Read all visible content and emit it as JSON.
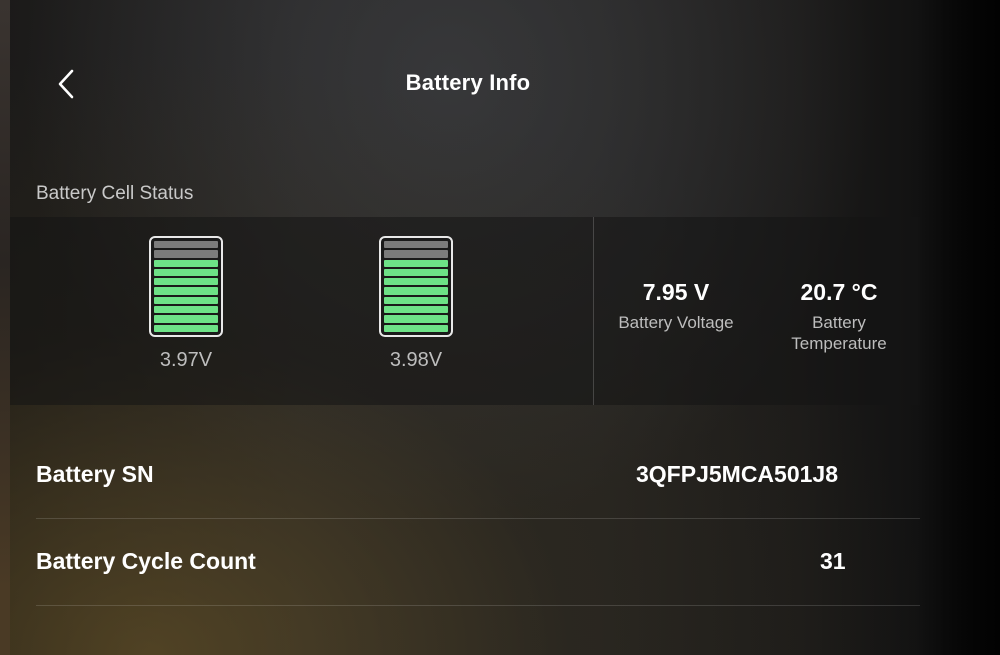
{
  "header": {
    "title": "Battery Info",
    "back_icon": "chevron-left-icon"
  },
  "cell_status": {
    "label": "Battery Cell Status",
    "cells": [
      {
        "voltage": "3.97V",
        "level_fraction": 0.8,
        "bars_total": 10,
        "bars_filled": 8
      },
      {
        "voltage": "3.98V",
        "level_fraction": 0.8,
        "bars_total": 10,
        "bars_filled": 8
      }
    ],
    "colors": {
      "filled": "#6de287",
      "empty": "#7b7b7b"
    }
  },
  "stats": {
    "voltage": {
      "value": "7.95 V",
      "label": "Battery Voltage"
    },
    "temperature": {
      "value": "20.7 °C",
      "label_line1": "Battery",
      "label_line2": "Temperature"
    }
  },
  "info": {
    "sn": {
      "label": "Battery SN",
      "value": "3QFPJ5MCA501J8"
    },
    "cycle": {
      "label": "Battery Cycle Count",
      "value": "31"
    }
  }
}
